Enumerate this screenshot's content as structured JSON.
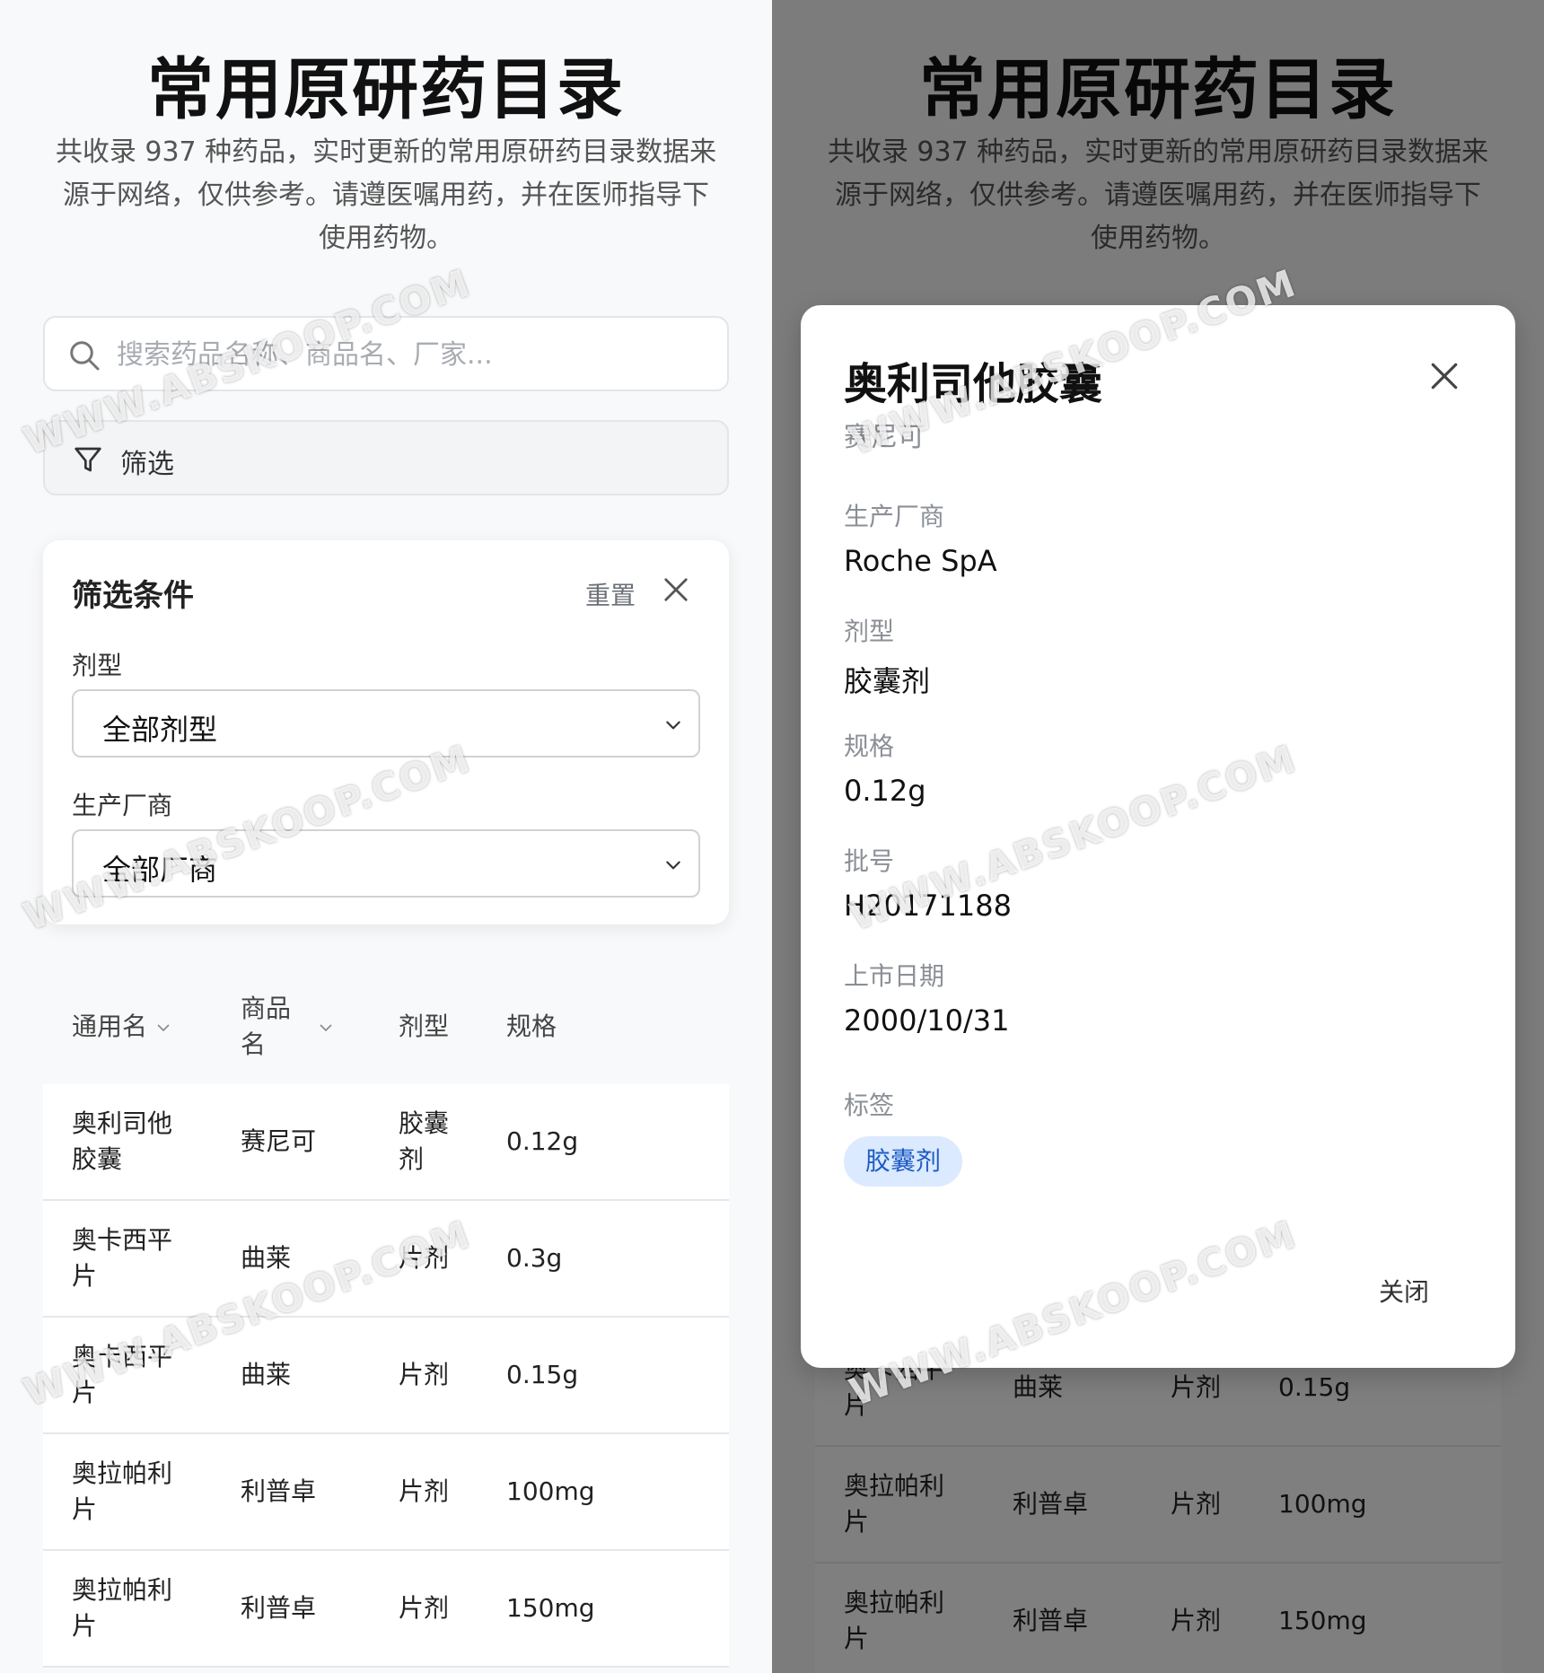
{
  "app": {
    "title": "常用原研药目录",
    "subtitle": "共收录 937 种药品，实时更新的常用原研药目录数据来源于网络，仅供参考。请遵医嘱用药，并在医师指导下使用药物。"
  },
  "search": {
    "placeholder": "搜索药品名称、商品名、厂家..."
  },
  "filter_button": {
    "label": "筛选"
  },
  "filter_panel": {
    "title": "筛选条件",
    "reset_label": "重置",
    "dosage_label": "剂型",
    "dosage_value": "全部剂型",
    "maker_label": "生产厂商",
    "maker_value": "全部厂商"
  },
  "table": {
    "headers": {
      "generic": "通用名",
      "brand": "商品名",
      "form": "剂型",
      "spec": "规格"
    },
    "rows": [
      {
        "generic": "奥利司他胶囊",
        "brand": "赛尼可",
        "form": "胶囊剂",
        "spec": "0.12g"
      },
      {
        "generic": "奥卡西平片",
        "brand": "曲莱",
        "form": "片剂",
        "spec": "0.3g"
      },
      {
        "generic": "奥卡西平片",
        "brand": "曲莱",
        "form": "片剂",
        "spec": "0.15g"
      },
      {
        "generic": "奥拉帕利片",
        "brand": "利普卓",
        "form": "片剂",
        "spec": "100mg"
      },
      {
        "generic": "奥拉帕利片",
        "brand": "利普卓",
        "form": "片剂",
        "spec": "150mg"
      }
    ]
  },
  "dialog": {
    "title": "奥利司他胶囊",
    "brand": "赛尼可",
    "maker_label": "生产厂商",
    "maker_value": "Roche SpA",
    "form_label": "剂型",
    "form_value": "胶囊剂",
    "spec_label": "规格",
    "spec_value": "0.12g",
    "batch_label": "批号",
    "batch_value": "H20171188",
    "date_label": "上市日期",
    "date_value": "2000/10/31",
    "tags_label": "标签",
    "tag": "胶囊剂",
    "close_label": "关闭"
  },
  "watermark": "WWW.ABSKOOP.COM",
  "colors": {
    "accent": "#1e5bc6",
    "tag_bg": "#dbeafe",
    "overlay": "#808080"
  }
}
